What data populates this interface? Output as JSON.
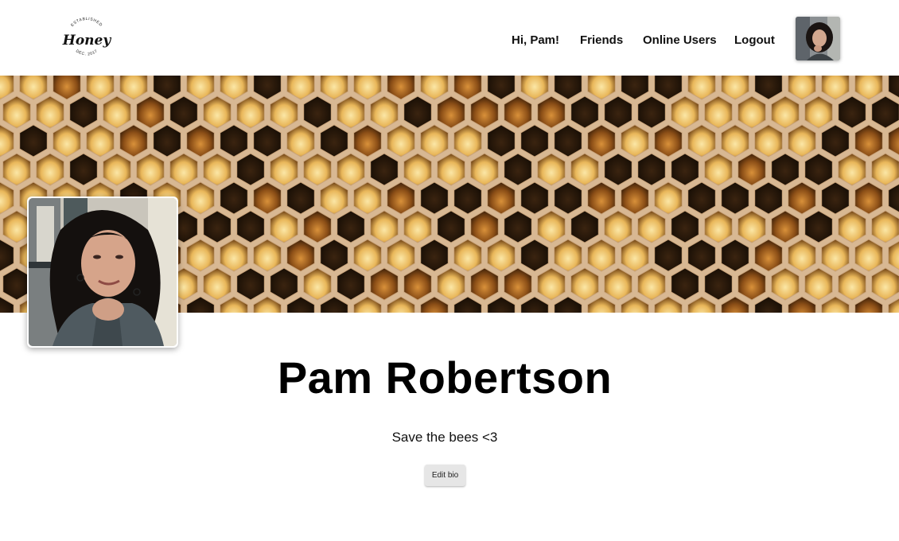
{
  "header": {
    "logo": {
      "top_text": "ESTABLISHED",
      "brand": "Honey",
      "bottom_text": "DEC. 2017"
    },
    "nav": {
      "greeting": "Hi, Pam!",
      "friends": "Friends",
      "online_users": "Online Users",
      "logout": "Logout"
    },
    "avatar_icon": "user-avatar"
  },
  "banner": {
    "image": "honeycomb-banner"
  },
  "profile": {
    "photo": "profile-photo",
    "name": "Pam Robertson",
    "bio": "Save the bees <3",
    "edit_bio_label": "Edit bio"
  },
  "colors": {
    "background": "#ffffff",
    "honey_light": "#f0c766",
    "honey_dark": "#2a1806",
    "wax": "#d9b995",
    "button_bg": "#e6e6e6"
  }
}
